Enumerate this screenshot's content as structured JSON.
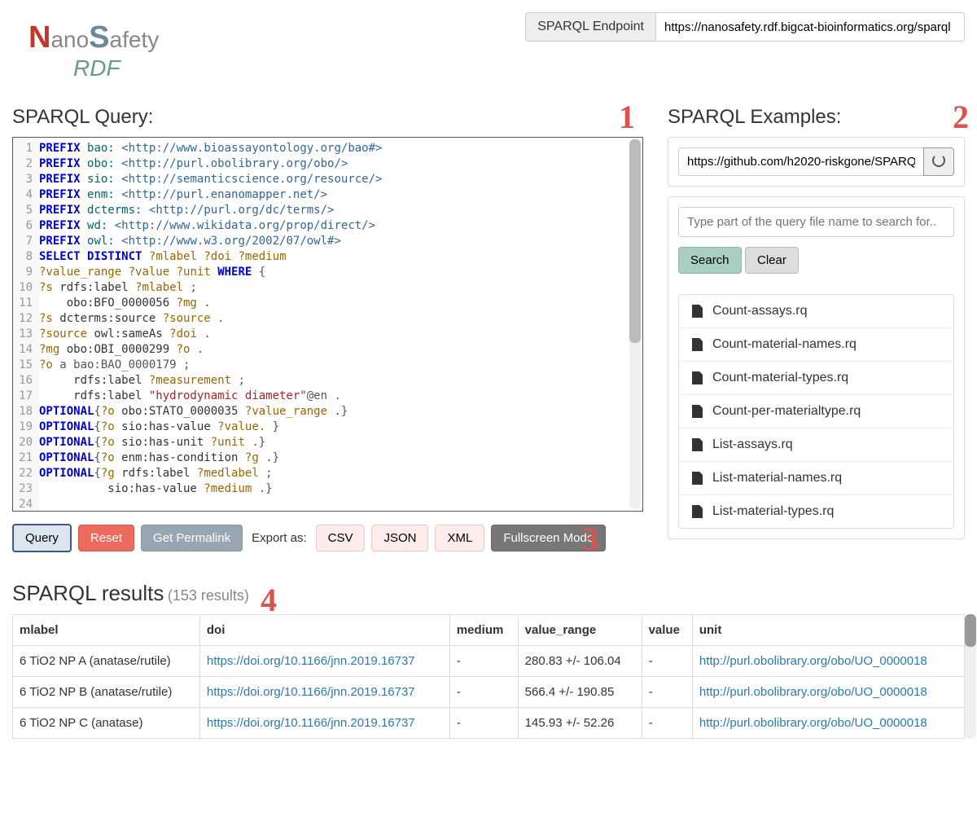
{
  "endpoint": {
    "label": "SPARQL Endpoint",
    "value": "https://nanosafety.rdf.bigcat-bioinformatics.org/sparql"
  },
  "logo": {
    "n": "N",
    "ano": "ano",
    "s": "S",
    "afety": "afety",
    "rdf": "RDF"
  },
  "query_section_title": "SPARQL Query:",
  "examples_section_title": "SPARQL Examples:",
  "annotations": {
    "a1": "1",
    "a2": "2",
    "a3": "3",
    "a4": "4"
  },
  "code_lines": [
    [
      {
        "t": "PREFIX",
        "c": "kw"
      },
      {
        "t": " "
      },
      {
        "t": "bao:",
        "c": "pr"
      },
      {
        "t": " "
      },
      {
        "t": "<http://www.bioassayontology.org/bao#>",
        "c": "iri"
      }
    ],
    [
      {
        "t": "PREFIX",
        "c": "kw"
      },
      {
        "t": " "
      },
      {
        "t": "obo:",
        "c": "pr"
      },
      {
        "t": " "
      },
      {
        "t": "<http://purl.obolibrary.org/obo/>",
        "c": "iri"
      }
    ],
    [
      {
        "t": "PREFIX",
        "c": "kw"
      },
      {
        "t": " "
      },
      {
        "t": "sio:",
        "c": "pr"
      },
      {
        "t": " "
      },
      {
        "t": "<http://semanticscience.org/resource/>",
        "c": "iri"
      }
    ],
    [
      {
        "t": "PREFIX",
        "c": "kw"
      },
      {
        "t": " "
      },
      {
        "t": "enm:",
        "c": "pr"
      },
      {
        "t": " "
      },
      {
        "t": "<http://purl.enanomapper.net/>",
        "c": "iri"
      }
    ],
    [
      {
        "t": "PREFIX",
        "c": "kw"
      },
      {
        "t": " "
      },
      {
        "t": "dcterms:",
        "c": "pr"
      },
      {
        "t": " "
      },
      {
        "t": "<http://purl.org/dc/terms/>",
        "c": "iri"
      }
    ],
    [
      {
        "t": "PREFIX",
        "c": "kw"
      },
      {
        "t": " "
      },
      {
        "t": "wd:",
        "c": "pr"
      },
      {
        "t": " "
      },
      {
        "t": "<http://www.wikidata.org/prop/direct/>",
        "c": "iri"
      }
    ],
    [
      {
        "t": "PREFIX",
        "c": "kw"
      },
      {
        "t": " "
      },
      {
        "t": "owl:",
        "c": "pr"
      },
      {
        "t": " "
      },
      {
        "t": "<http://www.w3.org/2002/07/owl#>",
        "c": "iri"
      }
    ],
    [
      {
        "t": ""
      }
    ],
    [
      {
        "t": "SELECT",
        "c": "kw"
      },
      {
        "t": " "
      },
      {
        "t": "DISTINCT",
        "c": "kw"
      },
      {
        "t": " "
      },
      {
        "t": "?mlabel",
        "c": "var"
      },
      {
        "t": " "
      },
      {
        "t": "?doi",
        "c": "var"
      },
      {
        "t": " "
      },
      {
        "t": "?medium",
        "c": "var"
      }
    ],
    [
      {
        "t": "?value_range",
        "c": "var"
      },
      {
        "t": " "
      },
      {
        "t": "?value",
        "c": "var"
      },
      {
        "t": " "
      },
      {
        "t": "?unit",
        "c": "var"
      },
      {
        "t": " "
      },
      {
        "t": "WHERE",
        "c": "kw"
      },
      {
        "t": " {",
        "c": "punc"
      }
    ],
    [
      {
        "t": "?s",
        "c": "var"
      },
      {
        "t": " rdfs:label "
      },
      {
        "t": "?mlabel",
        "c": "var"
      },
      {
        "t": " ;",
        "c": "punc"
      }
    ],
    [
      {
        "t": "    obo:BFO_0000056 "
      },
      {
        "t": "?mg",
        "c": "var"
      },
      {
        "t": " .",
        "c": "punc"
      }
    ],
    [
      {
        "t": "?s",
        "c": "var"
      },
      {
        "t": " dcterms:source "
      },
      {
        "t": "?source",
        "c": "var"
      },
      {
        "t": " .",
        "c": "punc"
      }
    ],
    [
      {
        "t": "?source",
        "c": "var"
      },
      {
        "t": " owl:sameAs "
      },
      {
        "t": "?doi",
        "c": "var"
      },
      {
        "t": " .",
        "c": "punc"
      }
    ],
    [
      {
        "t": "?mg",
        "c": "var"
      },
      {
        "t": " obo:OBI_0000299 "
      },
      {
        "t": "?o",
        "c": "var"
      },
      {
        "t": " .",
        "c": "punc"
      }
    ],
    [
      {
        "t": "?o",
        "c": "var"
      },
      {
        "t": " a bao:BAO_0000179 ;",
        "c": "punc"
      }
    ],
    [
      {
        "t": "     rdfs:label "
      },
      {
        "t": "?measurement",
        "c": "var"
      },
      {
        "t": " ;",
        "c": "punc"
      }
    ],
    [
      {
        "t": "     rdfs:label "
      },
      {
        "t": "\"hydrodynamic diameter\"",
        "c": "str"
      },
      {
        "t": "@en .",
        "c": "punc"
      }
    ],
    [
      {
        "t": "OPTIONAL",
        "c": "kw"
      },
      {
        "t": "{",
        "c": "punc"
      },
      {
        "t": "?o",
        "c": "var"
      },
      {
        "t": " obo:STATO_0000035 "
      },
      {
        "t": "?value_range",
        "c": "var"
      },
      {
        "t": " .}",
        "c": "punc"
      }
    ],
    [
      {
        "t": "OPTIONAL",
        "c": "kw"
      },
      {
        "t": "{",
        "c": "punc"
      },
      {
        "t": "?o",
        "c": "var"
      },
      {
        "t": " sio:has-value "
      },
      {
        "t": "?value.",
        "c": "var"
      },
      {
        "t": " }",
        "c": "punc"
      }
    ],
    [
      {
        "t": "OPTIONAL",
        "c": "kw"
      },
      {
        "t": "{",
        "c": "punc"
      },
      {
        "t": "?o",
        "c": "var"
      },
      {
        "t": " sio:has-unit "
      },
      {
        "t": "?unit",
        "c": "var"
      },
      {
        "t": " .}",
        "c": "punc"
      }
    ],
    [
      {
        "t": "OPTIONAL",
        "c": "kw"
      },
      {
        "t": "{",
        "c": "punc"
      },
      {
        "t": "?o",
        "c": "var"
      },
      {
        "t": " enm:has-condition "
      },
      {
        "t": "?g",
        "c": "var"
      },
      {
        "t": " .}",
        "c": "punc"
      }
    ],
    [
      {
        "t": "OPTIONAL",
        "c": "kw"
      },
      {
        "t": "{",
        "c": "punc"
      },
      {
        "t": "?g",
        "c": "var"
      },
      {
        "t": " rdfs:label "
      },
      {
        "t": "?medlabel",
        "c": "var"
      },
      {
        "t": " ;",
        "c": "punc"
      }
    ],
    [
      {
        "t": "          sio:has-value "
      },
      {
        "t": "?medium",
        "c": "var"
      },
      {
        "t": " .}",
        "c": "punc"
      }
    ]
  ],
  "buttons": {
    "query": "Query",
    "reset": "Reset",
    "permalink": "Get Permalink",
    "export_label": "Export as:",
    "csv": "CSV",
    "json": "JSON",
    "xml": "XML",
    "fullscreen": "Fullscreen Mode"
  },
  "examples": {
    "github_value": "https://github.com/h2020-riskgone/SPARQ",
    "search_placeholder": "Type part of the query file name to search for..",
    "search": "Search",
    "clear": "Clear",
    "items": [
      "Count-assays.rq",
      "Count-material-names.rq",
      "Count-material-types.rq",
      "Count-per-materialtype.rq",
      "List-assays.rq",
      "List-material-names.rq",
      "List-material-types.rq"
    ]
  },
  "results": {
    "title": "SPARQL results",
    "count": "(153 results)",
    "headers": [
      "mlabel",
      "doi",
      "medium",
      "value_range",
      "value",
      "unit"
    ],
    "rows": [
      {
        "mlabel": "6 TiO2 NP A (anatase/rutile)",
        "doi": "https://doi.org/10.1166/jnn.2019.16737",
        "medium": "-",
        "value_range": "280.83 +/- 106.04",
        "value": "-",
        "unit": "http://purl.obolibrary.org/obo/UO_0000018"
      },
      {
        "mlabel": "6 TiO2 NP B (anatase/rutile)",
        "doi": "https://doi.org/10.1166/jnn.2019.16737",
        "medium": "-",
        "value_range": "566.4 +/- 190.85",
        "value": "-",
        "unit": "http://purl.obolibrary.org/obo/UO_0000018"
      },
      {
        "mlabel": "6 TiO2 NP C (anatase)",
        "doi": "https://doi.org/10.1166/jnn.2019.16737",
        "medium": "-",
        "value_range": "145.93 +/- 52.26",
        "value": "-",
        "unit": "http://purl.obolibrary.org/obo/UO_0000018"
      }
    ]
  }
}
